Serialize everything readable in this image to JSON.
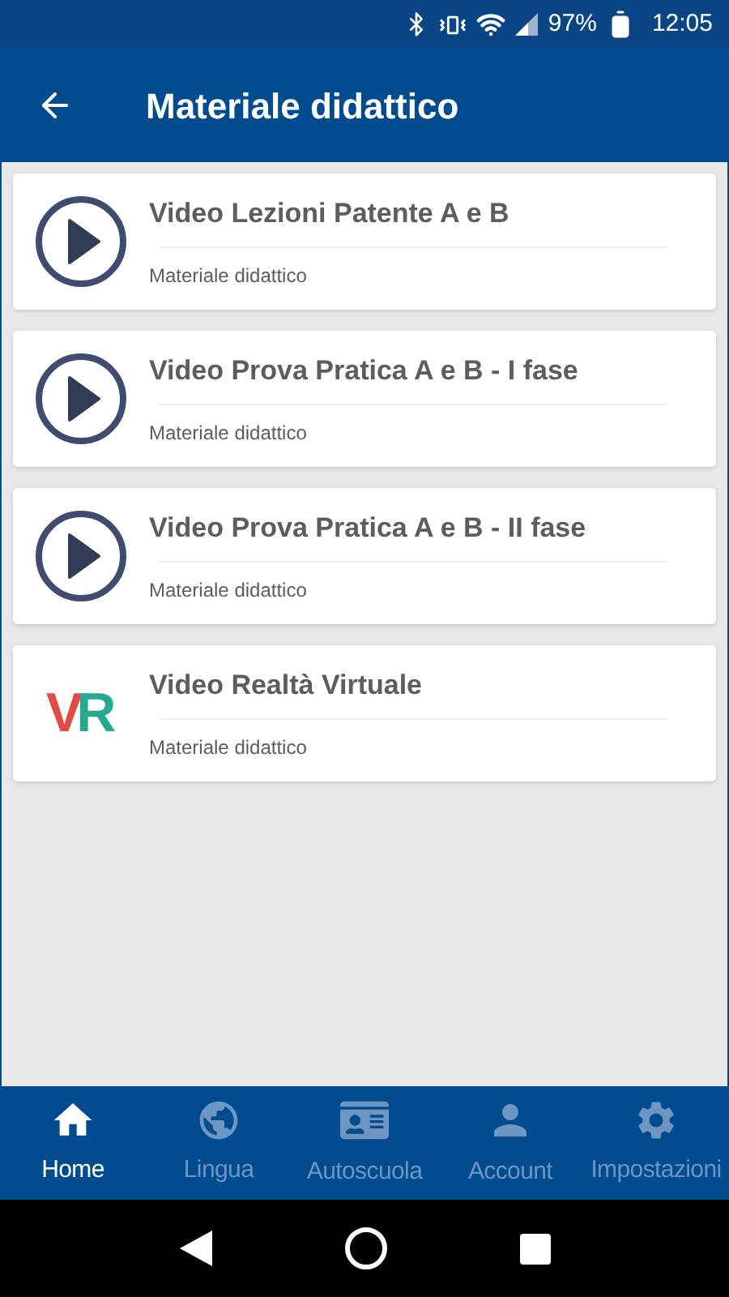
{
  "status_bar": {
    "battery": "97%",
    "time": "12:05"
  },
  "app_bar": {
    "title": "Materiale didattico"
  },
  "items": [
    {
      "kind": "play",
      "title": "Video Lezioni Patente A e B",
      "subtitle": "Materiale didattico"
    },
    {
      "kind": "play",
      "title": "Video Prova Pratica A e B - I fase",
      "subtitle": "Materiale didattico"
    },
    {
      "kind": "play",
      "title": "Video Prova Pratica A e B - II fase",
      "subtitle": "Materiale didattico"
    },
    {
      "kind": "logo",
      "logo_text": "VR",
      "title": "Video Realtà Virtuale",
      "subtitle": "Materiale didattico"
    }
  ],
  "bottom_nav": [
    {
      "label": "Home",
      "selected": true
    },
    {
      "label": "Lingua",
      "selected": false
    },
    {
      "label": "Autoscuola",
      "selected": false
    },
    {
      "label": "Account",
      "selected": false
    },
    {
      "label": "Impostazioni",
      "selected": false
    }
  ]
}
